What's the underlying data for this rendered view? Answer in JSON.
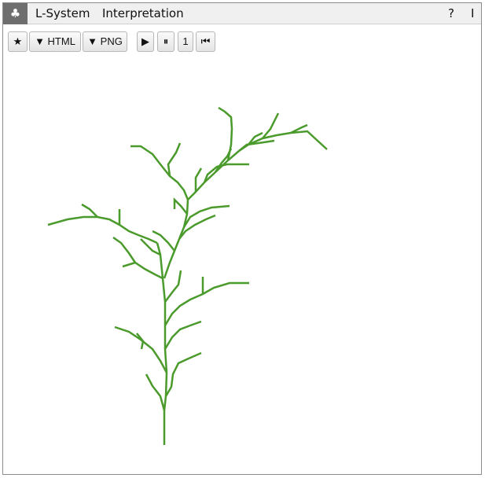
{
  "menubar": {
    "app_icon": "♣",
    "menu_lsystem": "L-System",
    "menu_interpretation": "Interpretation",
    "help": "?",
    "info": "I"
  },
  "toolbar": {
    "star": "★",
    "export_html": "▼ HTML",
    "export_png": "▼ PNG",
    "play": "▶",
    "pause": "⏸",
    "step": "1",
    "rewind": "⏮"
  },
  "drawing": {
    "stroke_color": "#4a9a2c"
  }
}
